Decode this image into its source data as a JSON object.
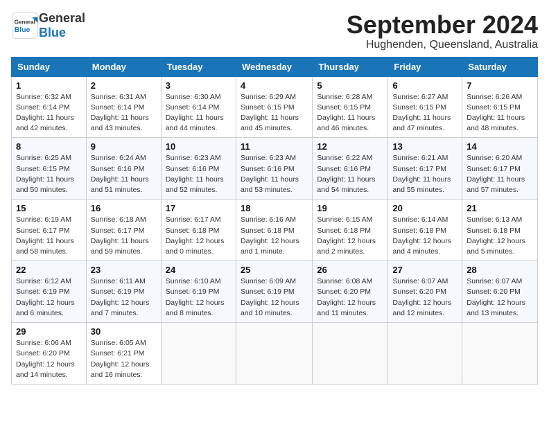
{
  "header": {
    "logo_general": "General",
    "logo_blue": "Blue",
    "month_title": "September 2024",
    "subtitle": "Hughenden, Queensland, Australia"
  },
  "days_of_week": [
    "Sunday",
    "Monday",
    "Tuesday",
    "Wednesday",
    "Thursday",
    "Friday",
    "Saturday"
  ],
  "weeks": [
    [
      {
        "day": "1",
        "info": "Sunrise: 6:32 AM\nSunset: 6:14 PM\nDaylight: 11 hours\nand 42 minutes."
      },
      {
        "day": "2",
        "info": "Sunrise: 6:31 AM\nSunset: 6:14 PM\nDaylight: 11 hours\nand 43 minutes."
      },
      {
        "day": "3",
        "info": "Sunrise: 6:30 AM\nSunset: 6:14 PM\nDaylight: 11 hours\nand 44 minutes."
      },
      {
        "day": "4",
        "info": "Sunrise: 6:29 AM\nSunset: 6:15 PM\nDaylight: 11 hours\nand 45 minutes."
      },
      {
        "day": "5",
        "info": "Sunrise: 6:28 AM\nSunset: 6:15 PM\nDaylight: 11 hours\nand 46 minutes."
      },
      {
        "day": "6",
        "info": "Sunrise: 6:27 AM\nSunset: 6:15 PM\nDaylight: 11 hours\nand 47 minutes."
      },
      {
        "day": "7",
        "info": "Sunrise: 6:26 AM\nSunset: 6:15 PM\nDaylight: 11 hours\nand 48 minutes."
      }
    ],
    [
      {
        "day": "8",
        "info": "Sunrise: 6:25 AM\nSunset: 6:15 PM\nDaylight: 11 hours\nand 50 minutes."
      },
      {
        "day": "9",
        "info": "Sunrise: 6:24 AM\nSunset: 6:16 PM\nDaylight: 11 hours\nand 51 minutes."
      },
      {
        "day": "10",
        "info": "Sunrise: 6:23 AM\nSunset: 6:16 PM\nDaylight: 11 hours\nand 52 minutes."
      },
      {
        "day": "11",
        "info": "Sunrise: 6:23 AM\nSunset: 6:16 PM\nDaylight: 11 hours\nand 53 minutes."
      },
      {
        "day": "12",
        "info": "Sunrise: 6:22 AM\nSunset: 6:16 PM\nDaylight: 11 hours\nand 54 minutes."
      },
      {
        "day": "13",
        "info": "Sunrise: 6:21 AM\nSunset: 6:17 PM\nDaylight: 11 hours\nand 55 minutes."
      },
      {
        "day": "14",
        "info": "Sunrise: 6:20 AM\nSunset: 6:17 PM\nDaylight: 11 hours\nand 57 minutes."
      }
    ],
    [
      {
        "day": "15",
        "info": "Sunrise: 6:19 AM\nSunset: 6:17 PM\nDaylight: 11 hours\nand 58 minutes."
      },
      {
        "day": "16",
        "info": "Sunrise: 6:18 AM\nSunset: 6:17 PM\nDaylight: 11 hours\nand 59 minutes."
      },
      {
        "day": "17",
        "info": "Sunrise: 6:17 AM\nSunset: 6:18 PM\nDaylight: 12 hours\nand 0 minutes."
      },
      {
        "day": "18",
        "info": "Sunrise: 6:16 AM\nSunset: 6:18 PM\nDaylight: 12 hours\nand 1 minute."
      },
      {
        "day": "19",
        "info": "Sunrise: 6:15 AM\nSunset: 6:18 PM\nDaylight: 12 hours\nand 2 minutes."
      },
      {
        "day": "20",
        "info": "Sunrise: 6:14 AM\nSunset: 6:18 PM\nDaylight: 12 hours\nand 4 minutes."
      },
      {
        "day": "21",
        "info": "Sunrise: 6:13 AM\nSunset: 6:18 PM\nDaylight: 12 hours\nand 5 minutes."
      }
    ],
    [
      {
        "day": "22",
        "info": "Sunrise: 6:12 AM\nSunset: 6:19 PM\nDaylight: 12 hours\nand 6 minutes."
      },
      {
        "day": "23",
        "info": "Sunrise: 6:11 AM\nSunset: 6:19 PM\nDaylight: 12 hours\nand 7 minutes."
      },
      {
        "day": "24",
        "info": "Sunrise: 6:10 AM\nSunset: 6:19 PM\nDaylight: 12 hours\nand 8 minutes."
      },
      {
        "day": "25",
        "info": "Sunrise: 6:09 AM\nSunset: 6:19 PM\nDaylight: 12 hours\nand 10 minutes."
      },
      {
        "day": "26",
        "info": "Sunrise: 6:08 AM\nSunset: 6:20 PM\nDaylight: 12 hours\nand 11 minutes."
      },
      {
        "day": "27",
        "info": "Sunrise: 6:07 AM\nSunset: 6:20 PM\nDaylight: 12 hours\nand 12 minutes."
      },
      {
        "day": "28",
        "info": "Sunrise: 6:07 AM\nSunset: 6:20 PM\nDaylight: 12 hours\nand 13 minutes."
      }
    ],
    [
      {
        "day": "29",
        "info": "Sunrise: 6:06 AM\nSunset: 6:20 PM\nDaylight: 12 hours\nand 14 minutes."
      },
      {
        "day": "30",
        "info": "Sunrise: 6:05 AM\nSunset: 6:21 PM\nDaylight: 12 hours\nand 16 minutes."
      },
      {
        "day": "",
        "info": ""
      },
      {
        "day": "",
        "info": ""
      },
      {
        "day": "",
        "info": ""
      },
      {
        "day": "",
        "info": ""
      },
      {
        "day": "",
        "info": ""
      }
    ]
  ]
}
